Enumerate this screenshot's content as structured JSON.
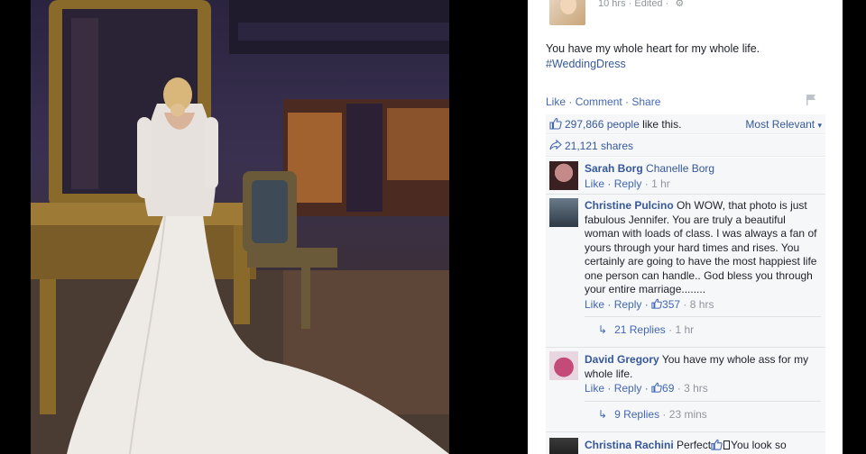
{
  "post": {
    "meta_time": "10 hrs",
    "meta_sep": " · ",
    "meta_edited": "Edited",
    "meta_sep2": " · ",
    "text": "You have my whole heart for my whole life.",
    "hashtag": "#WeddingDress"
  },
  "actions": {
    "like": "Like",
    "sep1": " · ",
    "comment": "Comment",
    "sep2": " · ",
    "share": "Share"
  },
  "likes": {
    "count": "297,866 people",
    "suffix": " like this.",
    "sort_label": "Most Relevant",
    "sort_caret": "▾"
  },
  "shares": {
    "text": "21,121 shares"
  },
  "comments": [
    {
      "name": "Sarah Borg",
      "text": " Chanelle Borg",
      "like": "Like",
      "reply": "Reply",
      "time": "1 hr"
    },
    {
      "name": "Christine Pulcino",
      "text": " Oh WOW, that photo is just fabulous Jennifer. You are truly a beautiful woman with loads of class. I was always a fan of yours through your hard times and rises. You certainly are going to have the most happiest life one person can handle.. God bless you through your entire marriage........",
      "like": "Like",
      "reply": "Reply",
      "likes": "357",
      "time": "8 hrs",
      "replies_label": "21 Replies",
      "replies_time": "1 hr"
    },
    {
      "name": "David Gregory",
      "text": " You have my whole ass for my whole life.",
      "like": "Like",
      "reply": "Reply",
      "likes": "69",
      "time": "3 hrs",
      "replies_label": "9 Replies",
      "replies_time": "23 mins"
    },
    {
      "name": "Christina Rachini",
      "text_before": " Perfect",
      "text_after": "You look so"
    }
  ],
  "colors": {
    "link": "#365899",
    "action": "#4267b2",
    "muted": "#90949c",
    "panel_bg": "#f6f7f9"
  }
}
